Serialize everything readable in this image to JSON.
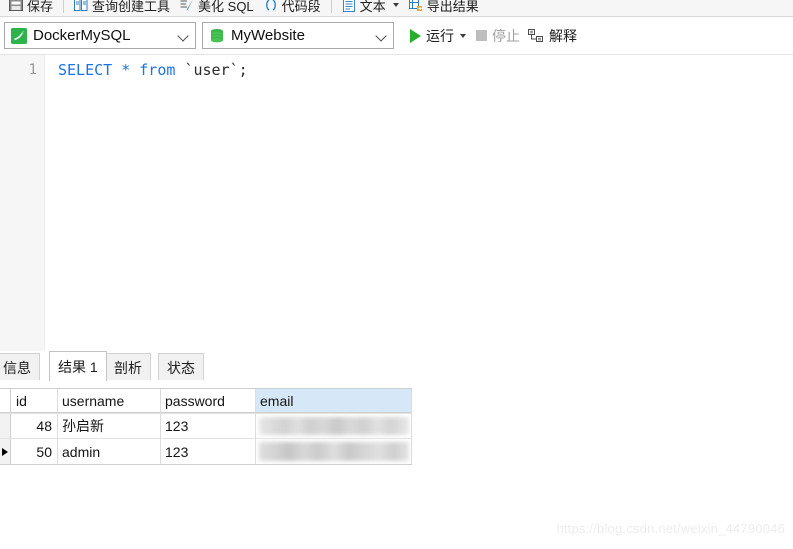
{
  "toolbar": {
    "items": [
      {
        "label": "保存",
        "icon": "save-icon"
      },
      {
        "label": "查询创建工具",
        "icon": "query-builder-icon"
      },
      {
        "label": "美化 SQL",
        "icon": "beautify-sql-icon"
      },
      {
        "label": "代码段",
        "icon": "code-snippet-icon"
      },
      {
        "label": "文本",
        "icon": "text-icon"
      },
      {
        "label": "导出结果",
        "icon": "export-result-icon"
      }
    ]
  },
  "selectors": {
    "connection": {
      "value": "DockerMySQL",
      "icon": "mysql-dolphin-icon",
      "arrow": "chevron-down-icon"
    },
    "database": {
      "value": "MyWebsite",
      "icon": "database-cylinder-icon",
      "arrow": "chevron-down-icon"
    },
    "run": {
      "label": "运行",
      "icon": "play-triangle-icon",
      "caret": "caret-down-icon",
      "enabled": true
    },
    "stop": {
      "label": "停止",
      "icon": "stop-square-icon",
      "enabled": false
    },
    "explain": {
      "label": "解释",
      "icon": "explain-plan-icon"
    }
  },
  "editor": {
    "line_number": "1",
    "tokens": {
      "select": "SELECT",
      "star": "*",
      "from": "from",
      "table": "`user`",
      "semicolon": ";"
    }
  },
  "result_tabs": [
    {
      "label": "信息",
      "active": false
    },
    {
      "label": "结果 1",
      "active": true
    },
    {
      "label": "剖析",
      "active": false
    },
    {
      "label": "状态",
      "active": false
    }
  ],
  "result_grid": {
    "columns": [
      "id",
      "username",
      "password",
      "email"
    ],
    "selected_column": "email",
    "current_row_index": 1,
    "rows": [
      {
        "id": "48",
        "username": "孙启新",
        "password": "123",
        "email": ""
      },
      {
        "id": "50",
        "username": "admin",
        "password": "123",
        "email": ""
      }
    ]
  },
  "watermark": {
    "text": "https://blog.csdn.net/weixin_44790046"
  },
  "colors": {
    "accent_green": "#27ae2b",
    "keyword_blue": "#1a73e8",
    "selected_header": "#d6e8f7",
    "toolbar_bg": "#f6f6f6"
  }
}
